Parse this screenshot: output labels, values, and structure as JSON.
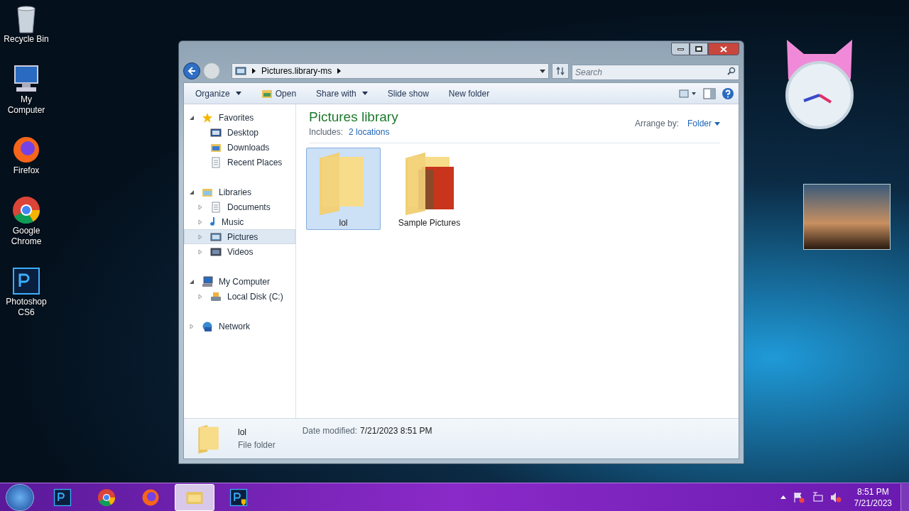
{
  "desktop_icons": [
    {
      "label": "Recycle Bin",
      "kind": "bin"
    },
    {
      "label": "My Computer",
      "kind": "computer"
    },
    {
      "label": "Firefox",
      "kind": "firefox"
    },
    {
      "label": "Google Chrome",
      "kind": "chrome"
    },
    {
      "label": "Photoshop CS6",
      "kind": "photoshop"
    }
  ],
  "window": {
    "address": "Pictures.library-ms",
    "search": {
      "placeholder": "Search"
    },
    "toolbar": [
      {
        "label": "Organize",
        "kind": "menu"
      },
      {
        "label": "Open",
        "kind": "icon"
      },
      {
        "label": "Share with",
        "kind": "menu"
      },
      {
        "label": "Slide show",
        "kind": "plain"
      },
      {
        "label": "New folder",
        "kind": "plain"
      }
    ],
    "nav": [
      {
        "label": "Favorites",
        "kind": "star",
        "expanded": true,
        "selected": false,
        "children": [
          {
            "label": "Desktop",
            "kind": "desktop",
            "selected": false
          },
          {
            "label": "Downloads",
            "kind": "downloads",
            "selected": false
          },
          {
            "label": "Recent Places",
            "kind": "recent",
            "selected": false
          }
        ]
      },
      {
        "label": "Libraries",
        "kind": "library",
        "expanded": true,
        "selected": false,
        "children": [
          {
            "label": "Documents",
            "kind": "documents",
            "expanded": false,
            "selected": false
          },
          {
            "label": "Music",
            "kind": "music",
            "expanded": false,
            "selected": false
          },
          {
            "label": "Pictures",
            "kind": "pictures",
            "expanded": false,
            "selected": true
          },
          {
            "label": "Videos",
            "kind": "videos",
            "expanded": false,
            "selected": false
          }
        ]
      },
      {
        "label": "My Computer",
        "kind": "computer",
        "expanded": true,
        "selected": false,
        "children": [
          {
            "label": "Local Disk (C:)",
            "kind": "disk",
            "expanded": false,
            "selected": false
          }
        ]
      },
      {
        "label": "Network",
        "kind": "network",
        "expanded": false,
        "selected": false
      }
    ],
    "heading": "Pictures library",
    "includes_label": "Includes:",
    "includes_link": "2 locations",
    "arrange_label": "Arrange by:",
    "arrange_value": "Folder",
    "files": [
      {
        "name": "lol",
        "kind": "folder",
        "selected": true
      },
      {
        "name": "Sample Pictures",
        "kind": "photo-folder",
        "selected": false
      }
    ],
    "details": {
      "name": "lol",
      "type": "File folder",
      "date_label": "Date modified:",
      "date_value": "7/21/2023 8:51 PM"
    }
  },
  "taskbar": {
    "items": [
      {
        "kind": "photoshop",
        "active": false
      },
      {
        "kind": "chrome",
        "active": false
      },
      {
        "kind": "firefox",
        "active": false
      },
      {
        "kind": "explorer",
        "active": true
      },
      {
        "kind": "photoshop-shield",
        "active": false
      }
    ],
    "time": "8:51 PM",
    "date": "7/21/2023"
  }
}
